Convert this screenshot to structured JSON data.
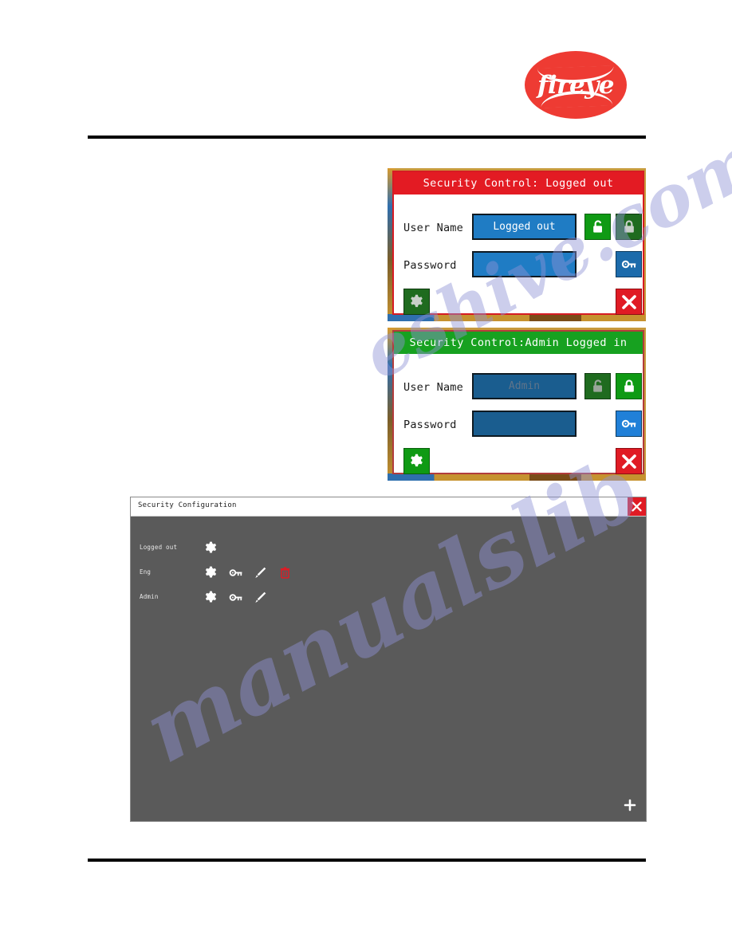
{
  "brand": {
    "logo_text": "fireye"
  },
  "watermarks": [
    "eshive.com",
    "manualslib"
  ],
  "dialog_logged_out": {
    "title": "Security Control: Logged out",
    "user_name_label": "User Name",
    "user_name_value": "Logged out",
    "password_label": "Password",
    "password_value": "",
    "buttons": {
      "unlock": "unlock-icon",
      "lock": "lock-icon",
      "key": "key-icon",
      "settings": "gear-icon",
      "close": "close-icon"
    }
  },
  "dialog_admin_logged_in": {
    "title": "Security Control:Admin Logged in",
    "user_name_label": "User Name",
    "user_name_value": "Admin",
    "password_label": "Password",
    "password_value": "",
    "buttons": {
      "unlock": "unlock-icon",
      "lock": "lock-icon",
      "key": "key-icon",
      "settings": "gear-icon",
      "close": "close-icon"
    }
  },
  "security_configuration": {
    "title": "Security Configuration",
    "close_label": "close-icon",
    "add_label": "plus-icon",
    "rows": [
      {
        "label": "Logged out",
        "actions": [
          "settings"
        ]
      },
      {
        "label": "Eng",
        "actions": [
          "settings",
          "password",
          "edit",
          "delete"
        ]
      },
      {
        "label": "Admin",
        "actions": [
          "settings",
          "password",
          "edit"
        ]
      }
    ]
  },
  "colors": {
    "header_red": "#e31b23",
    "header_green": "#17a120",
    "input_blue": "#1f7cc4",
    "input_blue_dark": "#1a5d8f",
    "button_green": "#0f9a14",
    "button_green_disabled": "#1f6b1f",
    "button_blue": "#1c6bab",
    "button_red": "#e01b24",
    "window_gray": "#5a5a5a",
    "brand_red": "#ee3b33"
  }
}
